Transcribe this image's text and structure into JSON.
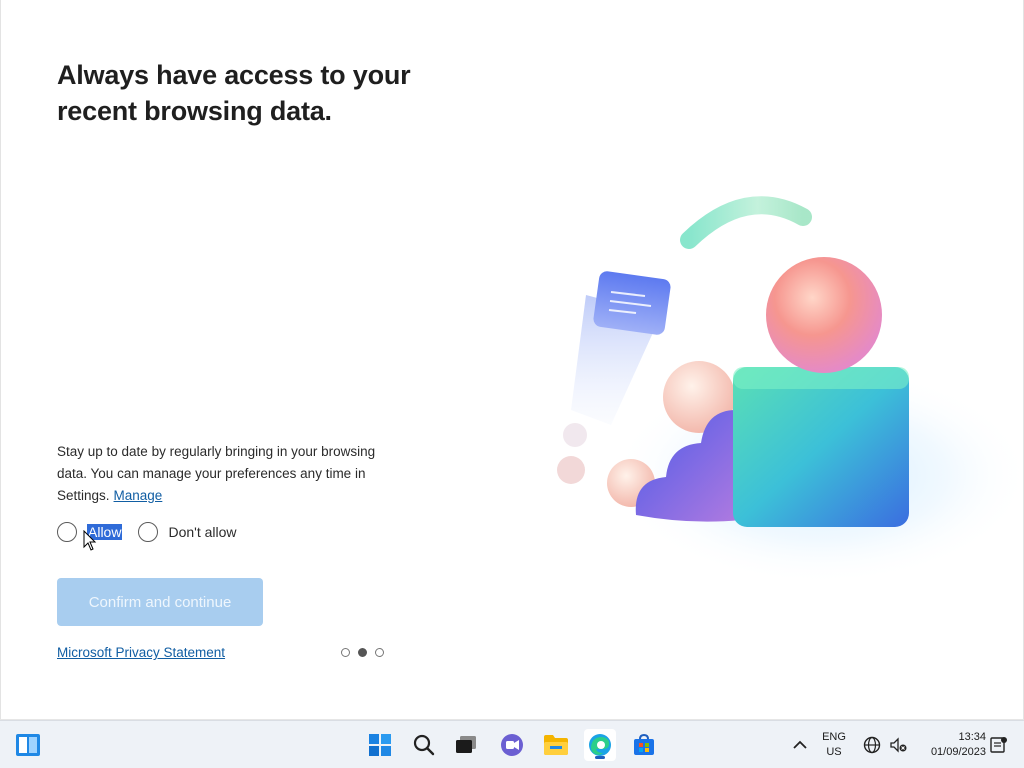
{
  "page": {
    "title": "Always have access to your recent browsing data.",
    "description": "Stay up to date by regularly bringing in your browsing data. You can manage your preferences any time in Settings.",
    "manage_link": "Manage",
    "options": [
      {
        "label": "Allow",
        "selected": false
      },
      {
        "label": "Don't allow",
        "selected": false
      }
    ],
    "confirm_button": "Confirm and continue",
    "privacy_link": "Microsoft Privacy Statement",
    "pagination": {
      "total": 3,
      "current": 2
    }
  },
  "taskbar": {
    "icons": [
      "widgets-icon",
      "start-icon",
      "search-icon",
      "task-view-icon",
      "teams-chat-icon",
      "file-explorer-icon",
      "edge-icon",
      "store-icon"
    ],
    "language": "ENG",
    "region": "US",
    "time": "13:34",
    "date": "01/09/2023"
  },
  "colors": {
    "accent": "#115ea3",
    "button_disabled": "#a8cdef",
    "selection": "#2f6bd8"
  }
}
